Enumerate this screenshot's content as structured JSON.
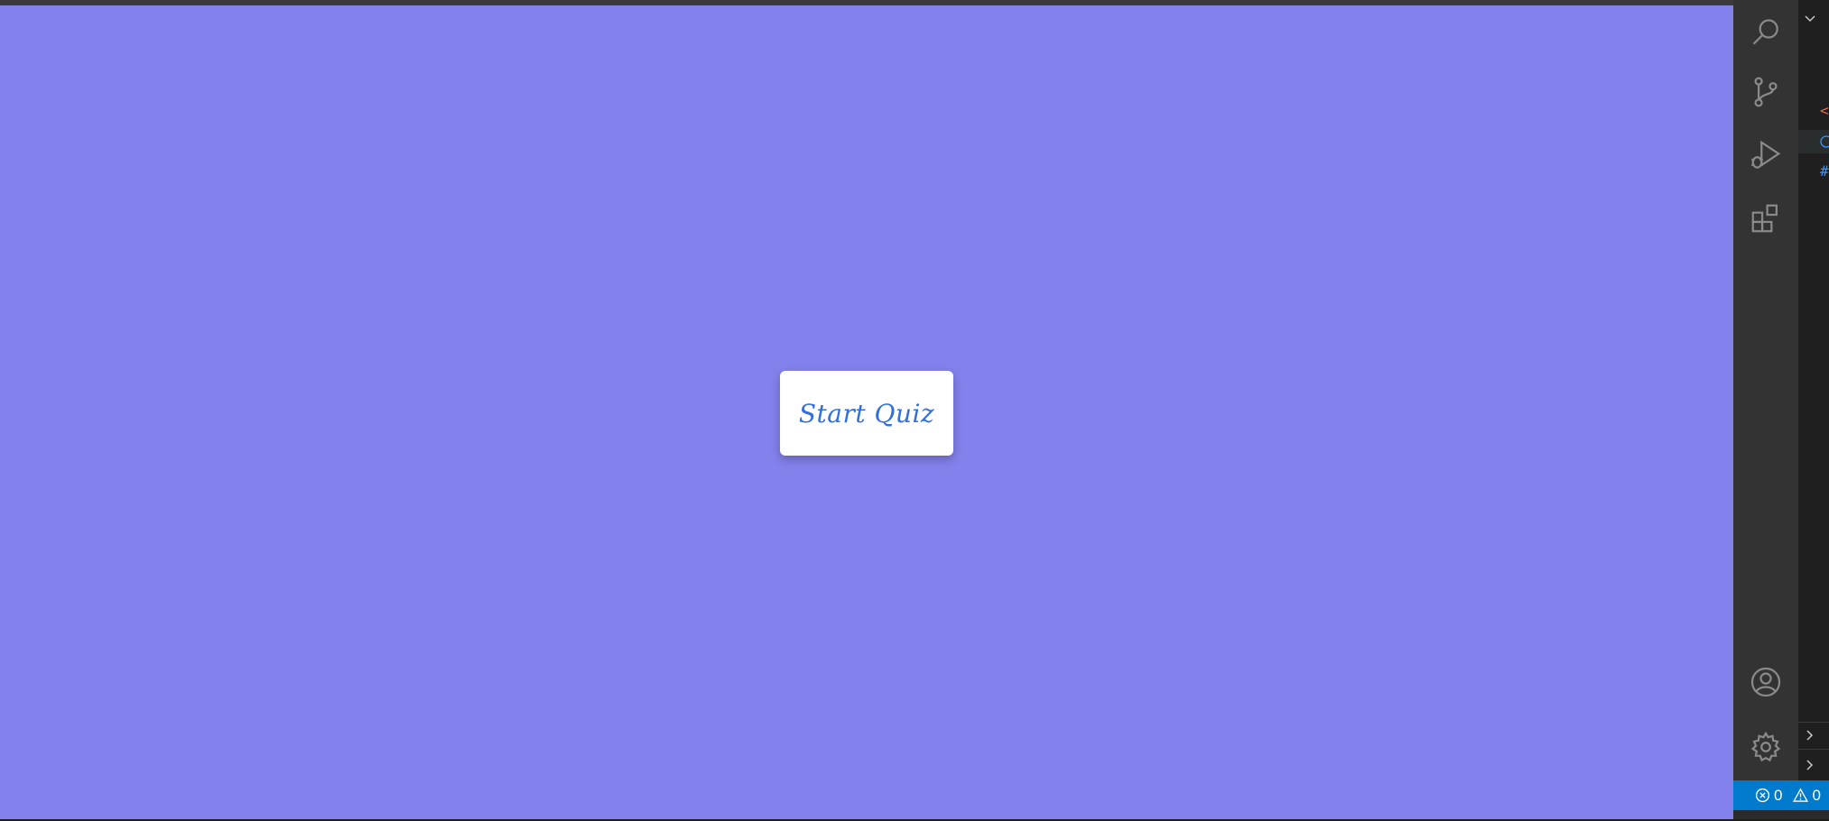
{
  "preview": {
    "background": "#8381eb",
    "start_button_label": "Start Quiz",
    "start_button_color": "#2f6fe0"
  },
  "activity_bar": {
    "icons": [
      "search-icon",
      "source-control-icon",
      "run-debug-icon",
      "extensions-icon",
      "account-icon",
      "settings-gear-icon"
    ]
  },
  "status_bar": {
    "errors": "0",
    "warnings": "0",
    "background": "#007acc"
  }
}
